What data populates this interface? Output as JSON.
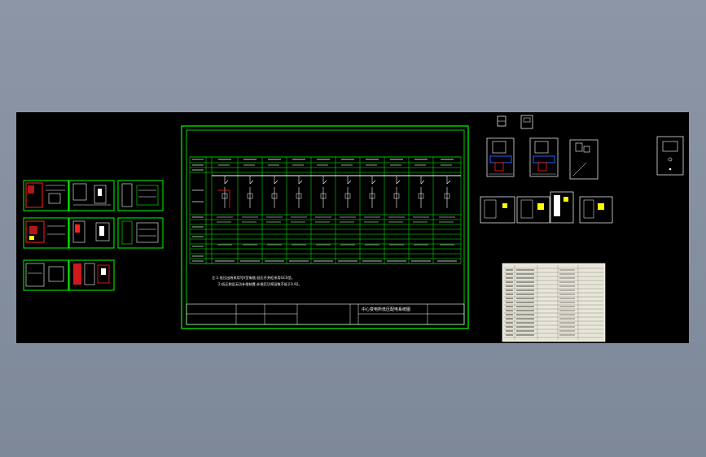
{
  "viewport": {
    "background": "#000000",
    "line_color": "#00ff00",
    "accent_red": "#ff2020",
    "accent_blue": "#2060ff",
    "accent_yellow": "#ffff00"
  },
  "main_sheet": {
    "title_block": {
      "drawing_title": "中心变电所低压配电系统图",
      "left_label": "",
      "cells": [
        "",
        "",
        "",
        ""
      ]
    },
    "notes": {
      "line1": "注:1.低压出线采用YJV型电缆,低压开关柜采用GCS型。",
      "line2": "2.低压侧设无功补偿装置,补偿后功率因数不低于0.92。"
    },
    "feeder_labels": [
      "",
      ""
    ]
  },
  "materials_table": {
    "background": "#e8e6d8"
  }
}
